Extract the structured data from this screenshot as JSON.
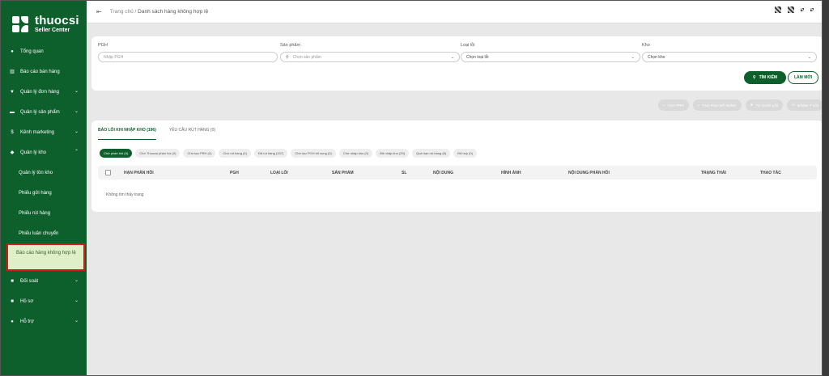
{
  "app": {
    "name": "thuocsi",
    "subtitle": "Seller Center"
  },
  "sidebar": {
    "items": [
      {
        "label": "Tổng quan",
        "icon": "dashboard-icon"
      },
      {
        "label": "Báo cáo bán hàng",
        "icon": "chart-icon"
      },
      {
        "label": "Quản lý đơn hàng",
        "icon": "cart-icon",
        "chevron": "down"
      },
      {
        "label": "Quản lý sản phẩm",
        "icon": "product-icon",
        "chevron": "down"
      },
      {
        "label": "Kênh marketing",
        "icon": "dollar-icon",
        "chevron": "down"
      },
      {
        "label": "Quản lý kho",
        "icon": "warehouse-icon",
        "chevron": "up"
      }
    ],
    "subitems": [
      {
        "label": "Quản lý tồn kho"
      },
      {
        "label": "Phiếu gửi hàng"
      },
      {
        "label": "Phiếu rút hàng"
      },
      {
        "label": "Phiếu luân chuyển"
      },
      {
        "label": "Báo cáo hàng không hợp lệ"
      }
    ],
    "bottom_items": [
      {
        "label": "Đối soát",
        "icon": "doc-icon",
        "chevron": "down"
      },
      {
        "label": "Hồ sơ",
        "icon": "doc-icon",
        "chevron": "down"
      },
      {
        "label": "Hỗ trợ",
        "icon": "help-icon",
        "chevron": "down"
      }
    ]
  },
  "breadcrumb": {
    "home": "Trang chủ",
    "separator": "/",
    "current": "Danh sách hàng không hợp lệ"
  },
  "filters": {
    "pgh": {
      "label": "PGH",
      "placeholder": "Nhập PGH"
    },
    "product": {
      "label": "Sản phẩm",
      "placeholder": "Chọn sản phẩm"
    },
    "error_type": {
      "label": "Loại lỗi",
      "value": "Chọn loại lỗi"
    },
    "warehouse": {
      "label": "Kho",
      "value": "Chọn kho"
    },
    "search_button": "TÌM KIẾM",
    "reset_button": "LÀM MỚI"
  },
  "actions": [
    "TẠO PRH",
    "TẠO PGH BỔ SUNG",
    "TỪ CHỐI LỖI",
    "ĐỒNG Ý LỖI"
  ],
  "tabs": [
    {
      "label": "BÁO LỖI KHI NHẬP KHO (196)",
      "active": true
    },
    {
      "label": "YÊU CẦU RÚT HÀNG (0)",
      "active": false
    }
  ],
  "chips": [
    "Chờ phản hồi (0)",
    "Chờ Thuocsi phản hồi (0)",
    "Chờ tạo PRH (2)",
    "Chờ rút hàng (4)",
    "Đã rút hàng (157)",
    "Chờ tạo PGH bổ sung (0)",
    "Chờ nhập kho (0)",
    "Đã nhập kho (25)",
    "Quá hạn rút hàng (8)",
    "Đã huỷ (0)"
  ],
  "table": {
    "columns": [
      "HẠN PHẢN HỒI",
      "PGH",
      "LOẠI LỖI",
      "SẢN PHẨM",
      "SL",
      "NỘI DUNG",
      "HÌNH ẢNH",
      "NỘI DUNG PHẢN HỒI",
      "TRẠNG THÁI",
      "THAO TÁC"
    ],
    "empty_text": "Không tìm thấy trang"
  },
  "colors": {
    "brand": "#0d5f2c",
    "highlight": "#dff0c8",
    "highlight_border": "#d11a1a"
  }
}
